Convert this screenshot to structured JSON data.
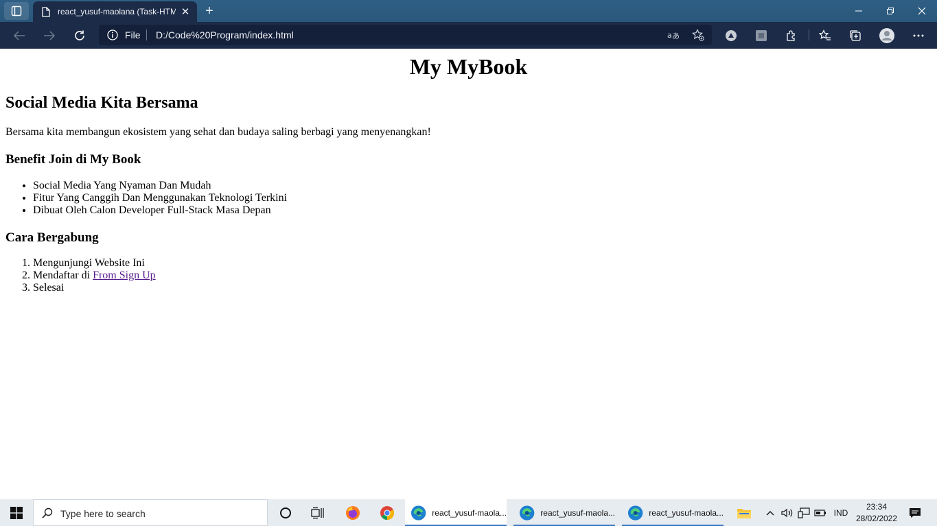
{
  "browser": {
    "tab_title": "react_yusuf-maolana (Task-HTML",
    "address_scheme": "File",
    "address_url": "D:/Code%20Program/index.html",
    "accent": "#1c2b48"
  },
  "page": {
    "title": "My MyBook",
    "heading": "Social Media Kita Bersama",
    "intro": "Bersama kita membangun ekosistem yang sehat dan budaya saling berbagi yang menyenangkan!",
    "benefits_heading": "Benefit Join di My Book",
    "benefits": [
      "Social Media Yang Nyaman Dan Mudah",
      "Fitur Yang Canggih Dan Menggunakan Teknologi Terkini",
      "Dibuat Oleh Calon Developer Full-Stack Masa Depan"
    ],
    "steps_heading": "Cara Bergabung",
    "steps": {
      "step1": "Mengunjungi Website Ini",
      "step2_prefix": "Mendaftar di ",
      "step2_link": "From Sign Up",
      "step3": "Selesai"
    }
  },
  "taskbar": {
    "search_placeholder": "Type here to search",
    "windows": [
      "react_yusuf-maola...",
      "react_yusuf-maola...",
      "react_yusuf-maola..."
    ],
    "language": "IND",
    "time": "23:34",
    "date": "28/02/2022"
  }
}
